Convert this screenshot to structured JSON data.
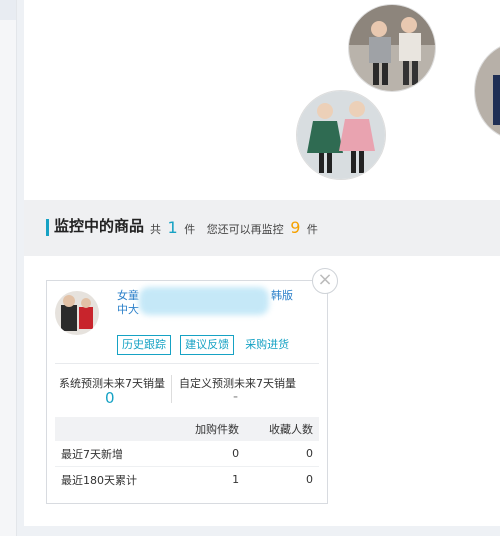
{
  "section": {
    "title": "监控中的商品",
    "count_prefix": "共",
    "count_value": "1",
    "count_unit": "件",
    "remaining_prefix": "您还可以再监控",
    "remaining_value": "9",
    "remaining_unit": "件",
    "accent_color": "#16a2c4",
    "highlight_color": "#f5a100"
  },
  "card": {
    "close_icon": "close-icon",
    "close_glyph": "×",
    "title_line1_start": "女童",
    "title_line1_end": "韩版",
    "title_line2_start": "中大",
    "buttons": {
      "history": "历史跟踪",
      "feedback": "建议反馈",
      "purchase": "采购进货"
    },
    "stats": {
      "system_label": "系统预测未来7天销量",
      "system_value": "0",
      "custom_label": "自定义预测未来7天销量",
      "custom_value": "-"
    },
    "table": {
      "headers": [
        "",
        "加购件数",
        "收藏人数"
      ],
      "rows": [
        {
          "label": "最近7天新增",
          "cart": "0",
          "fav": "0"
        },
        {
          "label": "最近180天累计",
          "cart": "1",
          "fav": "0"
        }
      ]
    }
  }
}
